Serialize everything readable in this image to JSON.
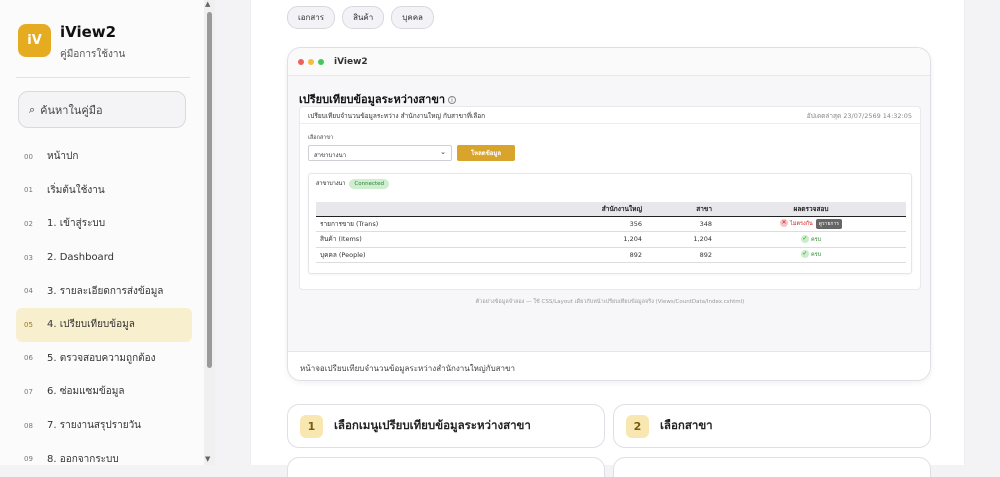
{
  "sidebar": {
    "logo_text": "iV",
    "title": "iView2",
    "subtitle": "คู่มือการใช้งาน",
    "search_placeholder": "ค้นหาในคู่มือ",
    "items": [
      {
        "num": "00",
        "label": "หน้าปก",
        "active": false
      },
      {
        "num": "01",
        "label": "เริ่มต้นใช้งาน",
        "active": false
      },
      {
        "num": "02",
        "label": "1. เข้าสู่ระบบ",
        "active": false
      },
      {
        "num": "03",
        "label": "2. Dashboard",
        "active": false
      },
      {
        "num": "04",
        "label": "3. รายละเอียดการส่งข้อมูล",
        "active": false
      },
      {
        "num": "05",
        "label": "4. เปรียบเทียบข้อมูล",
        "active": true
      },
      {
        "num": "06",
        "label": "5. ตรวจสอบความถูกต้อง",
        "active": false
      },
      {
        "num": "07",
        "label": "6. ซ่อมแซมข้อมูล",
        "active": false
      },
      {
        "num": "08",
        "label": "7. รายงานสรุปรายวัน",
        "active": false
      },
      {
        "num": "09",
        "label": "8. ออกจากระบบ",
        "active": false
      }
    ]
  },
  "tags": [
    "เอกสาร",
    "สินค้า",
    "บุคคล"
  ],
  "screenshot": {
    "window_title": "iView2",
    "page_title": "เปรียบเทียบข้อมูลระหว่างสาขา",
    "subtitle": "เปรียบเทียบจำนวนข้อมูลระหว่าง สำนักงานใหญ่ กับสาขาที่เลือก",
    "updated": "อัปเดตล่าสุด 23/07/2569 14:32:05",
    "branch_label": "เลือกสาขา",
    "branch_value": "สาขาบางนา",
    "load_button": "โหลดข้อมูล",
    "card_branch": "สาขาบางนา",
    "status_badge": "Connected",
    "columns": [
      "",
      "สำนักงานใหญ่",
      "สาขา",
      "ผลตรวจสอบ"
    ],
    "rows": [
      {
        "name": "รายการขาย (Trans)",
        "hq": "356",
        "branch": "348",
        "status": "bad",
        "result": "ไม่ตรงกัน",
        "detail": "ดูรายการ"
      },
      {
        "name": "สินค้า (Items)",
        "hq": "1,204",
        "branch": "1,204",
        "status": "ok",
        "result": "ครบ"
      },
      {
        "name": "บุคคล (People)",
        "hq": "892",
        "branch": "892",
        "status": "ok",
        "result": "ครบ"
      }
    ],
    "footnote": "ตัวอย่างข้อมูลจำลอง — ใช้ CSS/Layout เดียวกับหน้าเปรียบเทียบข้อมูลจริง (Views/CountData/Index.cshtml)",
    "caption": "หน้าจอเปรียบเทียบจำนวนข้อมูลระหว่างสำนักงานใหญ่กับสาขา"
  },
  "steps": [
    {
      "num": "1",
      "label": "เลือกเมนูเปรียบเทียบข้อมูลระหว่างสาขา"
    },
    {
      "num": "2",
      "label": "เลือกสาขา"
    }
  ],
  "colors": {
    "accent": "#e5ac22",
    "active_bg": "#f8efcf",
    "ok": "#2b8a2b",
    "bad": "#cc2222"
  }
}
